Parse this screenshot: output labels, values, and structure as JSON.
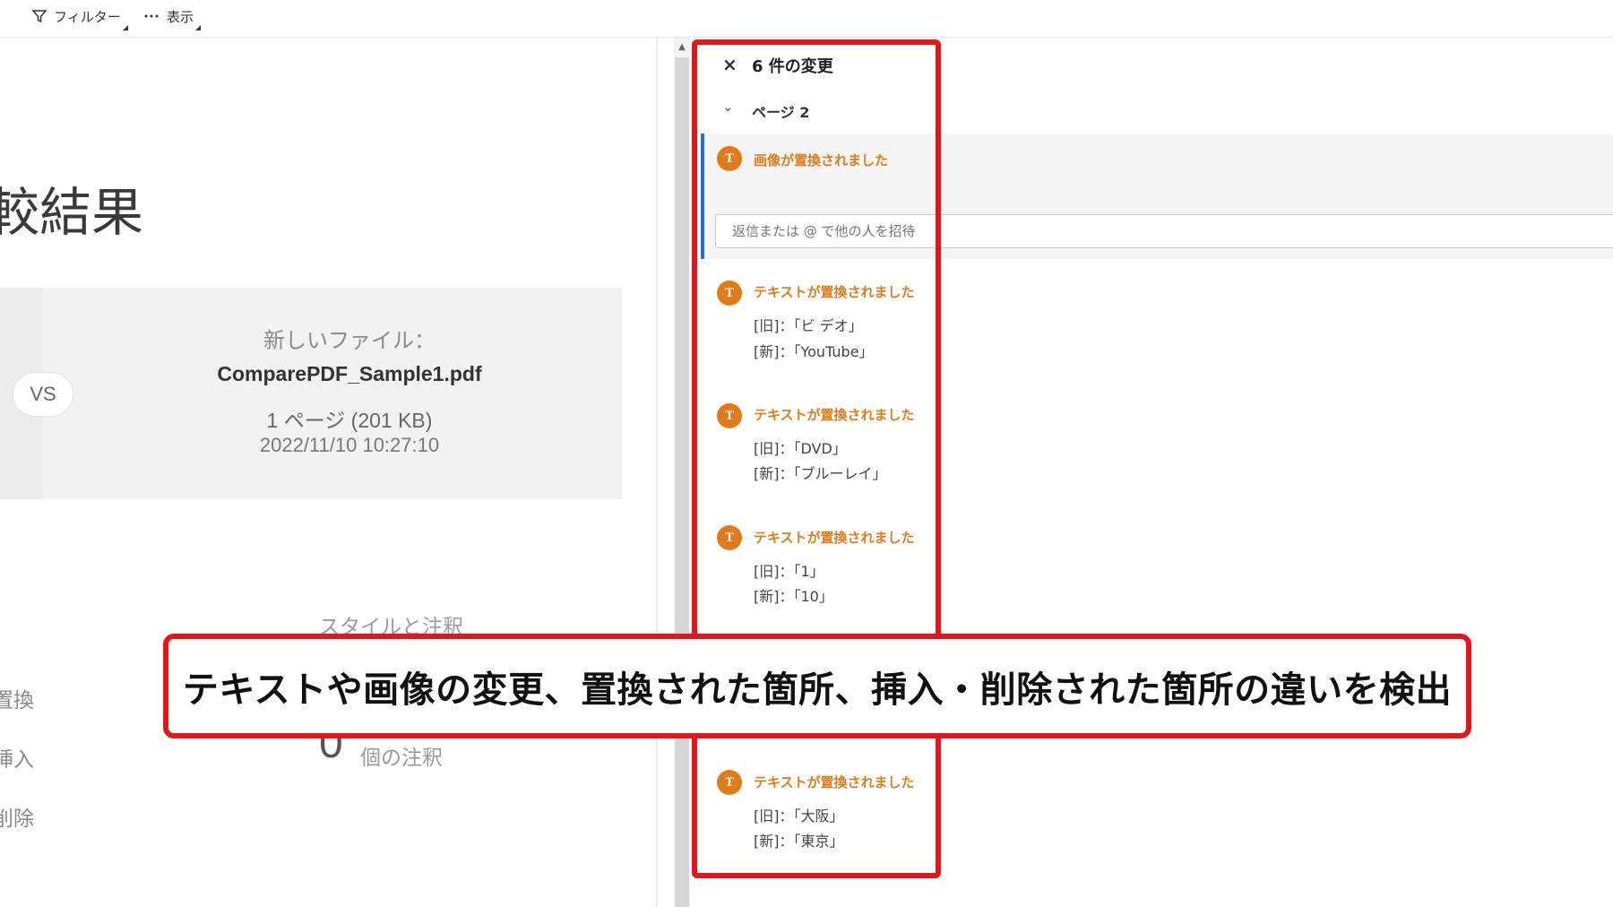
{
  "toolbar": {
    "filter_label": "フィルター",
    "view_label": "表示"
  },
  "report": {
    "title": "較結果",
    "vs_label": "VS",
    "new_file_label": "新しいファイル：",
    "new_file_name": "ComparePDF_Sample1.pdf",
    "new_file_pages": "1 ページ (201 KB)",
    "new_file_date": "2022/11/10 10:27:10",
    "styles_heading": "スタイルと注釈",
    "side_labels": [
      "置換",
      "挿入",
      "削除"
    ],
    "annotations_count": "0",
    "annotations_label": "個の注釈"
  },
  "panel": {
    "close_icon": "×",
    "title": "6 件の変更",
    "page_label": "ページ 2",
    "reply_placeholder": "返信または @ で他の人を招待",
    "accent_color": "#e07b1a",
    "selection_color": "#2b6cd8",
    "changes": [
      {
        "title": "画像が置換されました"
      },
      {
        "title": "テキストが置換されました",
        "old": "[旧]：「ビ デオ」",
        "new": "[新]：「YouTube」"
      },
      {
        "title": "テキストが置換されました",
        "old": "[旧]：「DVD」",
        "new": "[新]：「ブルーレイ」"
      },
      {
        "title": "テキストが置換されました",
        "old": "[旧]：「1」",
        "new": "[新]：「10」"
      },
      {
        "title": "テキストが置換されました",
        "old": "[旧]：「大阪」",
        "new": "[新]：「東京」"
      }
    ]
  },
  "caption": {
    "text": "テキストや画像の変更、置換された箇所、挿入・削除された箇所の違いを検出",
    "frame_color": "#e3161b"
  }
}
